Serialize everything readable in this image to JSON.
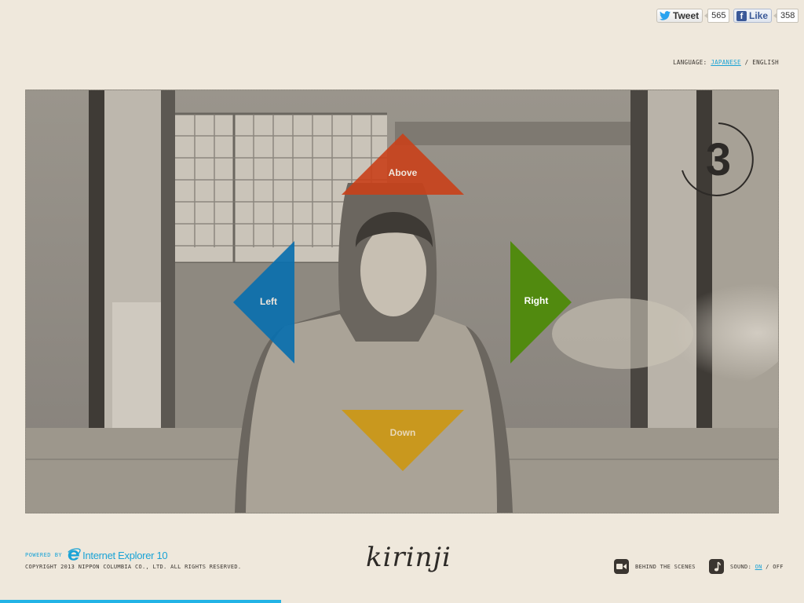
{
  "social": {
    "tweet_label": "Tweet",
    "tweet_count": "565",
    "like_label": "Like",
    "like_count": "358"
  },
  "language": {
    "label": "Language:",
    "options": [
      "Japanese",
      "English"
    ],
    "active": "Japanese",
    "separator": "/"
  },
  "stage": {
    "counter": "3",
    "directions": {
      "above": "Above",
      "left": "Left",
      "right": "Right",
      "down": "Down"
    },
    "colors": {
      "above": "#c9401a",
      "left": "#0a6fae",
      "right": "#4e8a08",
      "down": "#cf9608"
    }
  },
  "footer": {
    "powered_by": "Powered by",
    "ie_text": "Internet Explorer 10",
    "copyright": "Copyright 2013 Nippon Columbia Co., Ltd. All rights reserved.",
    "logo": "kirinji",
    "behind_the_scenes": "Behind the scenes",
    "sound_label": "Sound:",
    "sound_on": "On",
    "sound_off": "Off",
    "sound_separator": "/",
    "sound_state": "On"
  },
  "progress": {
    "fraction": 0.35
  }
}
